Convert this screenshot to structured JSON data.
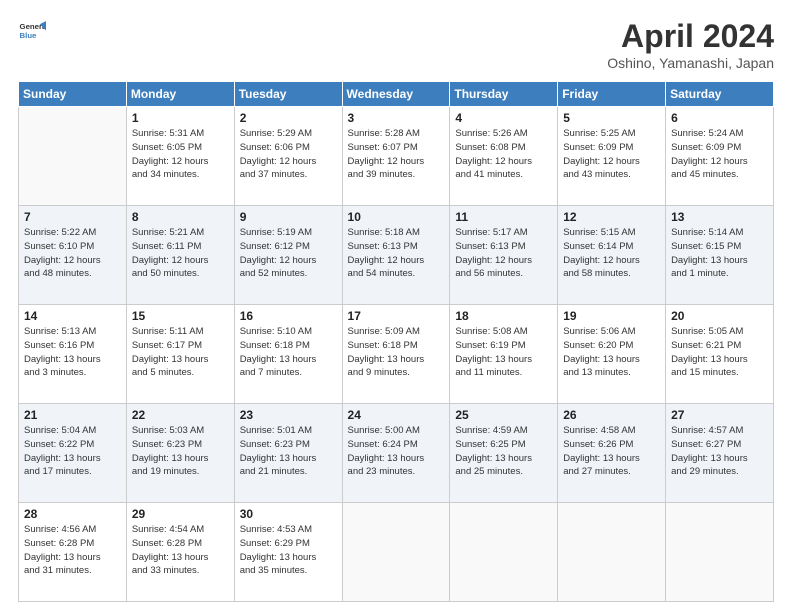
{
  "header": {
    "logo_line1": "General",
    "logo_line2": "Blue",
    "title": "April 2024",
    "subtitle": "Oshino, Yamanashi, Japan"
  },
  "weekdays": [
    "Sunday",
    "Monday",
    "Tuesday",
    "Wednesday",
    "Thursday",
    "Friday",
    "Saturday"
  ],
  "rows": [
    [
      {
        "num": "",
        "info": ""
      },
      {
        "num": "1",
        "info": "Sunrise: 5:31 AM\nSunset: 6:05 PM\nDaylight: 12 hours\nand 34 minutes."
      },
      {
        "num": "2",
        "info": "Sunrise: 5:29 AM\nSunset: 6:06 PM\nDaylight: 12 hours\nand 37 minutes."
      },
      {
        "num": "3",
        "info": "Sunrise: 5:28 AM\nSunset: 6:07 PM\nDaylight: 12 hours\nand 39 minutes."
      },
      {
        "num": "4",
        "info": "Sunrise: 5:26 AM\nSunset: 6:08 PM\nDaylight: 12 hours\nand 41 minutes."
      },
      {
        "num": "5",
        "info": "Sunrise: 5:25 AM\nSunset: 6:09 PM\nDaylight: 12 hours\nand 43 minutes."
      },
      {
        "num": "6",
        "info": "Sunrise: 5:24 AM\nSunset: 6:09 PM\nDaylight: 12 hours\nand 45 minutes."
      }
    ],
    [
      {
        "num": "7",
        "info": "Sunrise: 5:22 AM\nSunset: 6:10 PM\nDaylight: 12 hours\nand 48 minutes."
      },
      {
        "num": "8",
        "info": "Sunrise: 5:21 AM\nSunset: 6:11 PM\nDaylight: 12 hours\nand 50 minutes."
      },
      {
        "num": "9",
        "info": "Sunrise: 5:19 AM\nSunset: 6:12 PM\nDaylight: 12 hours\nand 52 minutes."
      },
      {
        "num": "10",
        "info": "Sunrise: 5:18 AM\nSunset: 6:13 PM\nDaylight: 12 hours\nand 54 minutes."
      },
      {
        "num": "11",
        "info": "Sunrise: 5:17 AM\nSunset: 6:13 PM\nDaylight: 12 hours\nand 56 minutes."
      },
      {
        "num": "12",
        "info": "Sunrise: 5:15 AM\nSunset: 6:14 PM\nDaylight: 12 hours\nand 58 minutes."
      },
      {
        "num": "13",
        "info": "Sunrise: 5:14 AM\nSunset: 6:15 PM\nDaylight: 13 hours\nand 1 minute."
      }
    ],
    [
      {
        "num": "14",
        "info": "Sunrise: 5:13 AM\nSunset: 6:16 PM\nDaylight: 13 hours\nand 3 minutes."
      },
      {
        "num": "15",
        "info": "Sunrise: 5:11 AM\nSunset: 6:17 PM\nDaylight: 13 hours\nand 5 minutes."
      },
      {
        "num": "16",
        "info": "Sunrise: 5:10 AM\nSunset: 6:18 PM\nDaylight: 13 hours\nand 7 minutes."
      },
      {
        "num": "17",
        "info": "Sunrise: 5:09 AM\nSunset: 6:18 PM\nDaylight: 13 hours\nand 9 minutes."
      },
      {
        "num": "18",
        "info": "Sunrise: 5:08 AM\nSunset: 6:19 PM\nDaylight: 13 hours\nand 11 minutes."
      },
      {
        "num": "19",
        "info": "Sunrise: 5:06 AM\nSunset: 6:20 PM\nDaylight: 13 hours\nand 13 minutes."
      },
      {
        "num": "20",
        "info": "Sunrise: 5:05 AM\nSunset: 6:21 PM\nDaylight: 13 hours\nand 15 minutes."
      }
    ],
    [
      {
        "num": "21",
        "info": "Sunrise: 5:04 AM\nSunset: 6:22 PM\nDaylight: 13 hours\nand 17 minutes."
      },
      {
        "num": "22",
        "info": "Sunrise: 5:03 AM\nSunset: 6:23 PM\nDaylight: 13 hours\nand 19 minutes."
      },
      {
        "num": "23",
        "info": "Sunrise: 5:01 AM\nSunset: 6:23 PM\nDaylight: 13 hours\nand 21 minutes."
      },
      {
        "num": "24",
        "info": "Sunrise: 5:00 AM\nSunset: 6:24 PM\nDaylight: 13 hours\nand 23 minutes."
      },
      {
        "num": "25",
        "info": "Sunrise: 4:59 AM\nSunset: 6:25 PM\nDaylight: 13 hours\nand 25 minutes."
      },
      {
        "num": "26",
        "info": "Sunrise: 4:58 AM\nSunset: 6:26 PM\nDaylight: 13 hours\nand 27 minutes."
      },
      {
        "num": "27",
        "info": "Sunrise: 4:57 AM\nSunset: 6:27 PM\nDaylight: 13 hours\nand 29 minutes."
      }
    ],
    [
      {
        "num": "28",
        "info": "Sunrise: 4:56 AM\nSunset: 6:28 PM\nDaylight: 13 hours\nand 31 minutes."
      },
      {
        "num": "29",
        "info": "Sunrise: 4:54 AM\nSunset: 6:28 PM\nDaylight: 13 hours\nand 33 minutes."
      },
      {
        "num": "30",
        "info": "Sunrise: 4:53 AM\nSunset: 6:29 PM\nDaylight: 13 hours\nand 35 minutes."
      },
      {
        "num": "",
        "info": ""
      },
      {
        "num": "",
        "info": ""
      },
      {
        "num": "",
        "info": ""
      },
      {
        "num": "",
        "info": ""
      }
    ]
  ]
}
